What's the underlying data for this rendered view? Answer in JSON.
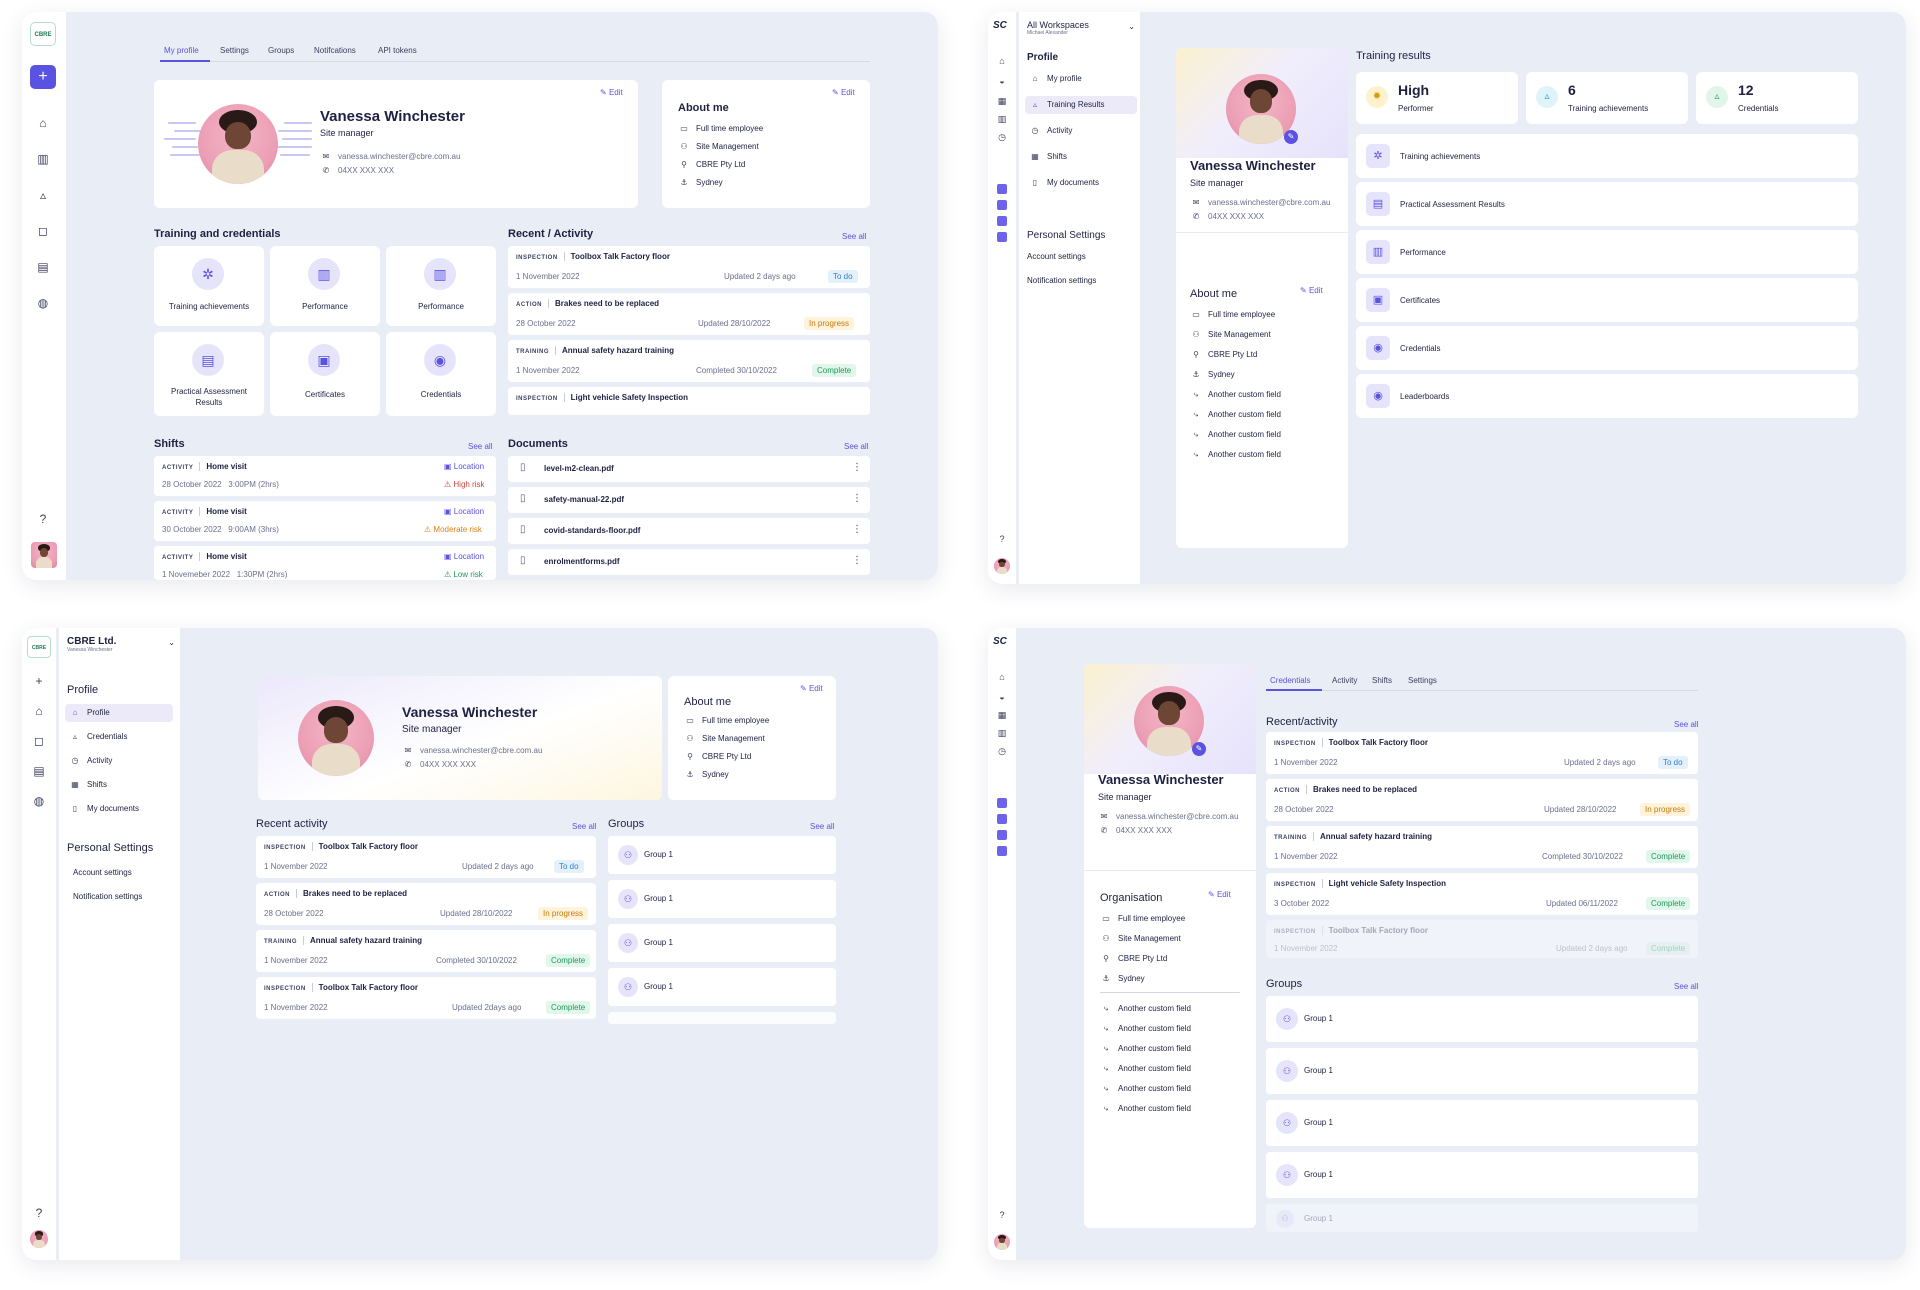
{
  "tl": {
    "logo": "CBRE",
    "tabs": [
      "My profile",
      "Settings",
      "Groups",
      "Notifcations",
      "API tokens"
    ],
    "name": "Vanessa Winchester",
    "role": "Site manager",
    "email": "vanessa.winchester@cbre.com.au",
    "phone": "04XX XXX XXX",
    "edit": "Edit",
    "about_title": "About me",
    "about": [
      "Full time employee",
      "Site Management",
      "CBRE Pty Ltd",
      "Sydney"
    ],
    "training_title": "Training and credentials",
    "tiles": [
      "Training achievements",
      "Performance",
      "Performance",
      "Practical Assessment Results",
      "Certificates",
      "Credentials"
    ],
    "activity_title": "Recent / Activity",
    "see_all": "See all",
    "activity": [
      {
        "tag": "INSPECTION",
        "title": "Toolbox Talk Factory floor",
        "date": "1 November 2022",
        "meta": "Updated 2 days ago",
        "status": "To do"
      },
      {
        "tag": "ACTION",
        "title": "Brakes need to be replaced",
        "date": "28 October 2022",
        "meta": "Updated 28/10/2022",
        "status": "In progress"
      },
      {
        "tag": "TRAINING",
        "title": "Annual safety hazard training",
        "date": "1 November 2022",
        "meta": "Completed 30/10/2022",
        "status": "Complete"
      },
      {
        "tag": "INSPECTION",
        "title": "Light vehicle Safety Inspection"
      }
    ],
    "shifts_title": "Shifts",
    "shifts": [
      {
        "tag": "ACTIVITY",
        "title": "Home visit",
        "loc": "Location",
        "date": "28 October 2022",
        "time": "3:00PM (2hrs)",
        "risk": "High risk"
      },
      {
        "tag": "ACTIVITY",
        "title": "Home visit",
        "loc": "Location",
        "date": "30 October 2022",
        "time": "9:00AM (3hrs)",
        "risk": "Moderate risk"
      },
      {
        "tag": "ACTIVITY",
        "title": "Home visit",
        "loc": "Location",
        "date": "1 Novemeber 2022",
        "time": "1:30PM (2hrs)",
        "risk": "Low risk"
      }
    ],
    "docs_title": "Documents",
    "docs": [
      "level-m2-clean.pdf",
      "safety-manual-22.pdf",
      "covid-standards-floor.pdf",
      "enrolmentforms.pdf"
    ]
  },
  "tr": {
    "workspace": "All Workspaces",
    "user": "Michael Alexander",
    "menu_title": "Profile",
    "menu": [
      "My profile",
      "Training Results",
      "Activity",
      "Shifts",
      "My documents"
    ],
    "settings_title": "Personal Settings",
    "settings": [
      "Account settings",
      "Notification settings"
    ],
    "name": "Vanessa Winchester",
    "role": "Site manager",
    "email": "vanessa.winchester@cbre.com.au",
    "phone": "04XX XXX XXX",
    "about_title": "About me",
    "edit": "Edit",
    "about": [
      "Full time employee",
      "Site Management",
      "CBRE Pty Ltd",
      "Sydney",
      "Another custom field",
      "Another custom field",
      "Another custom field",
      "Another custom field"
    ],
    "results_title": "Training results",
    "stats": [
      {
        "value": "High",
        "label": "Performer"
      },
      {
        "value": "6",
        "label": "Training achievements"
      },
      {
        "value": "12",
        "label": "Credentials"
      }
    ],
    "list": [
      "Training achievements",
      "Practical Assessment Results",
      "Performance",
      "Certificates",
      "Credentials",
      "Leaderboards"
    ]
  },
  "bl": {
    "org": "CBRE Ltd.",
    "user": "Vanessa Winchester",
    "menu_title": "Profile",
    "menu": [
      "Profile",
      "Credentials",
      "Activity",
      "Shifts",
      "My documents"
    ],
    "settings_title": "Personal Settings",
    "settings": [
      "Account settings",
      "Notification settings"
    ],
    "name": "Vanessa Winchester",
    "role": "Site manager",
    "email": "vanessa.winchester@cbre.com.au",
    "phone": "04XX XXX XXX",
    "about_title": "About me",
    "edit": "Edit",
    "about": [
      "Full time employee",
      "Site Management",
      "CBRE Pty Ltd",
      "Sydney"
    ],
    "activity_title": "Recent activity",
    "see_all": "See all",
    "activity": [
      {
        "tag": "INSPECTION",
        "title": "Toolbox Talk Factory floor",
        "date": "1 November 2022",
        "meta": "Updated 2 days ago",
        "status": "To do"
      },
      {
        "tag": "ACTION",
        "title": "Brakes need to be replaced",
        "date": "28 October 2022",
        "meta": "Updated 28/10/2022",
        "status": "In progress"
      },
      {
        "tag": "TRAINING",
        "title": "Annual safety hazard training",
        "date": "1 November 2022",
        "meta": "Completed 30/10/2022",
        "status": "Complete"
      },
      {
        "tag": "INSPECTION",
        "title": "Toolbox Talk Factory floor",
        "date": "1 November 2022",
        "meta": "Updated 2days ago",
        "status": "Complete"
      }
    ],
    "groups_title": "Groups",
    "groups": [
      "Group 1",
      "Group 1",
      "Group 1",
      "Group 1"
    ]
  },
  "br": {
    "name": "Vanessa Winchester",
    "role": "Site manager",
    "email": "vanessa.winchester@cbre.com.au",
    "phone": "04XX XXX XXX",
    "org_title": "Organisation",
    "edit": "Edit",
    "org": [
      "Full time employee",
      "Site Management",
      "CBRE Pty Ltd",
      "Sydney"
    ],
    "custom": [
      "Another custom field",
      "Another custom field",
      "Another custom field",
      "Another custom field",
      "Another custom field",
      "Another custom field"
    ],
    "tabs": [
      "Credentials",
      "Activity",
      "Shifts",
      "Settings"
    ],
    "activity_title": "Recent/activity",
    "see_all": "See all",
    "activity": [
      {
        "tag": "INSPECTION",
        "title": "Toolbox Talk Factory floor",
        "date": "1 November 2022",
        "meta": "Updated 2 days ago",
        "status": "To do"
      },
      {
        "tag": "ACTION",
        "title": "Brakes need to be replaced",
        "date": "28 October 2022",
        "meta": "Updated 28/10/2022",
        "status": "In progress"
      },
      {
        "tag": "TRAINING",
        "title": "Annual safety hazard training",
        "date": "1 November 2022",
        "meta": "Completed 30/10/2022",
        "status": "Complete"
      },
      {
        "tag": "INSPECTION",
        "title": "Light vehicle Safety Inspection",
        "date": "3 October 2022",
        "meta": "Updated 06/11/2022",
        "status": "Complete"
      },
      {
        "tag": "INSPECTION",
        "title": "Toolbox Talk Factory floor",
        "date": "1 November 2022",
        "meta": "Updated 2 days ago",
        "status": "Complete"
      }
    ],
    "groups_title": "Groups",
    "groups": [
      "Group 1",
      "Group 1",
      "Group 1",
      "Group 1",
      "Group 1"
    ]
  }
}
